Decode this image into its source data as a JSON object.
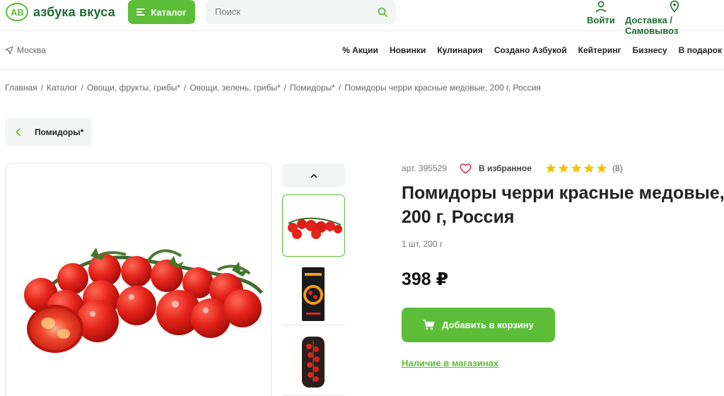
{
  "header": {
    "logo_text": "азбука вкуса",
    "catalog_label": "Каталог",
    "search_placeholder": "Поиск",
    "login_label": "Войти",
    "delivery_label": "Доставка / Самовывоз"
  },
  "nav": {
    "city": "Москва",
    "items": [
      "% Акции",
      "Новинки",
      "Кулинария",
      "Создано Азбукой",
      "Кейтеринг",
      "Бизнесу",
      "В подарок"
    ]
  },
  "breadcrumb": [
    "Главная",
    "Каталог",
    "Овощи, фрукты, грибы*",
    "Овощи, зелень, грибы*",
    "Помидоры*",
    "Помидоры черри красные медовые, 200 г, Россия"
  ],
  "back": {
    "label": "Помидоры*"
  },
  "product": {
    "article": "арт. 395529",
    "favorite_label": "В избранное",
    "rating_stars": 5,
    "rating_count": "(8)",
    "title_line1": "Помидоры черри красные медовые,",
    "title_line2": "200 г, Россия",
    "weight": "1 шт, 200 г",
    "price": "398 ₽",
    "add_to_cart_label": "Добавить в корзину",
    "stores_link": "Наличие в магазинах"
  },
  "colors": {
    "brand_green": "#5cbd39",
    "logo_green": "#1f6b34",
    "star": "#f2c400"
  }
}
